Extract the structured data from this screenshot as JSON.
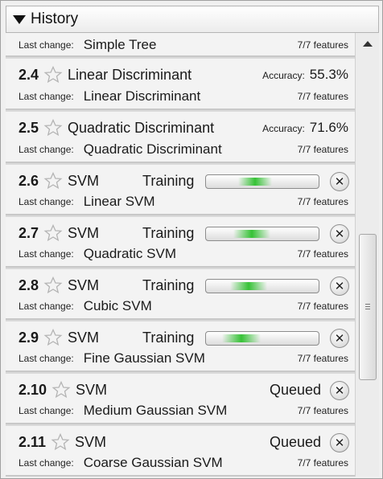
{
  "header": {
    "title": "History"
  },
  "labels": {
    "last_change": "Last change:",
    "accuracy": "Accuracy:"
  },
  "items": [
    {
      "num": "",
      "model": "",
      "last_change": "Simple Tree",
      "features": "7/7 features"
    },
    {
      "num": "2.4",
      "model": "Linear Discriminant",
      "accuracy": "55.3%",
      "last_change": "Linear Discriminant",
      "features": "7/7 features"
    },
    {
      "num": "2.5",
      "model": "Quadratic Discriminant",
      "accuracy": "71.6%",
      "last_change": "Quadratic Discriminant",
      "features": "7/7 features"
    },
    {
      "num": "2.6",
      "model": "SVM",
      "status": "Training",
      "last_change": "Linear SVM",
      "features": "7/7 features"
    },
    {
      "num": "2.7",
      "model": "SVM",
      "status": "Training",
      "last_change": "Quadratic SVM",
      "features": "7/7 features"
    },
    {
      "num": "2.8",
      "model": "SVM",
      "status": "Training",
      "last_change": "Cubic SVM",
      "features": "7/7 features"
    },
    {
      "num": "2.9",
      "model": "SVM",
      "status": "Training",
      "last_change": "Fine Gaussian SVM",
      "features": "7/7 features"
    },
    {
      "num": "2.10",
      "model": "SVM",
      "status": "Queued",
      "last_change": "Medium Gaussian SVM",
      "features": "7/7 features"
    },
    {
      "num": "2.11",
      "model": "SVM",
      "status": "Queued",
      "last_change": "Coarse Gaussian SVM",
      "features": "7/7 features"
    }
  ],
  "icons": {
    "collapse": "triangle-down-icon",
    "star": "star-outline-icon",
    "cancel": "close-circle-icon",
    "scroll_up": "arrow-up-icon"
  },
  "colors": {
    "progress": "#36c236",
    "panel": "#f0f0f0"
  }
}
